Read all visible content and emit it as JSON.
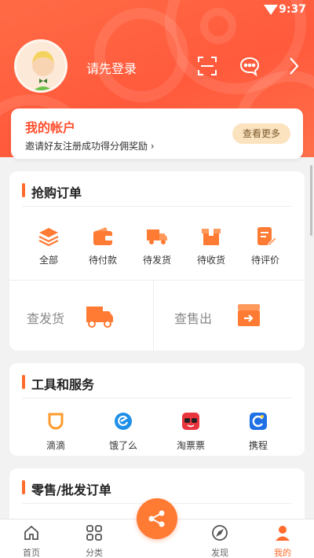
{
  "status_bar": {
    "time": "9:37"
  },
  "header": {
    "login_prompt": "请先登录"
  },
  "account": {
    "title": "我的帐户",
    "subtitle": "邀请好友注册成功得分佣奖励 ›",
    "more_button": "查看更多"
  },
  "purchase_orders": {
    "title": "抢购订单",
    "items": [
      {
        "label": "全部",
        "icon": "layers-icon"
      },
      {
        "label": "待付款",
        "icon": "wallet-icon"
      },
      {
        "label": "待发货",
        "icon": "truck-box-icon"
      },
      {
        "label": "待收货",
        "icon": "package-icon"
      },
      {
        "label": "待评价",
        "icon": "review-icon"
      }
    ],
    "quick": [
      {
        "label": "查发货",
        "icon": "truck-icon"
      },
      {
        "label": "查售出",
        "icon": "sold-box-icon"
      }
    ]
  },
  "tools": {
    "title": "工具和服务",
    "items": [
      {
        "label": "滴滴",
        "icon": "didi-icon"
      },
      {
        "label": "饿了么",
        "icon": "eleme-icon"
      },
      {
        "label": "淘票票",
        "icon": "taopiaopiao-icon"
      },
      {
        "label": "携程",
        "icon": "ctrip-icon"
      }
    ]
  },
  "retail_orders": {
    "title": "零售/批发订单"
  },
  "tabbar": {
    "items": [
      {
        "label": "首页",
        "icon": "home-icon"
      },
      {
        "label": "分类",
        "icon": "grid-icon"
      },
      {
        "label": "",
        "icon": "share-icon"
      },
      {
        "label": "发现",
        "icon": "compass-icon"
      },
      {
        "label": "我的",
        "icon": "user-icon",
        "active": true
      }
    ]
  },
  "colors": {
    "accent": "#ff6b2c",
    "header": "#ff5a3c"
  }
}
